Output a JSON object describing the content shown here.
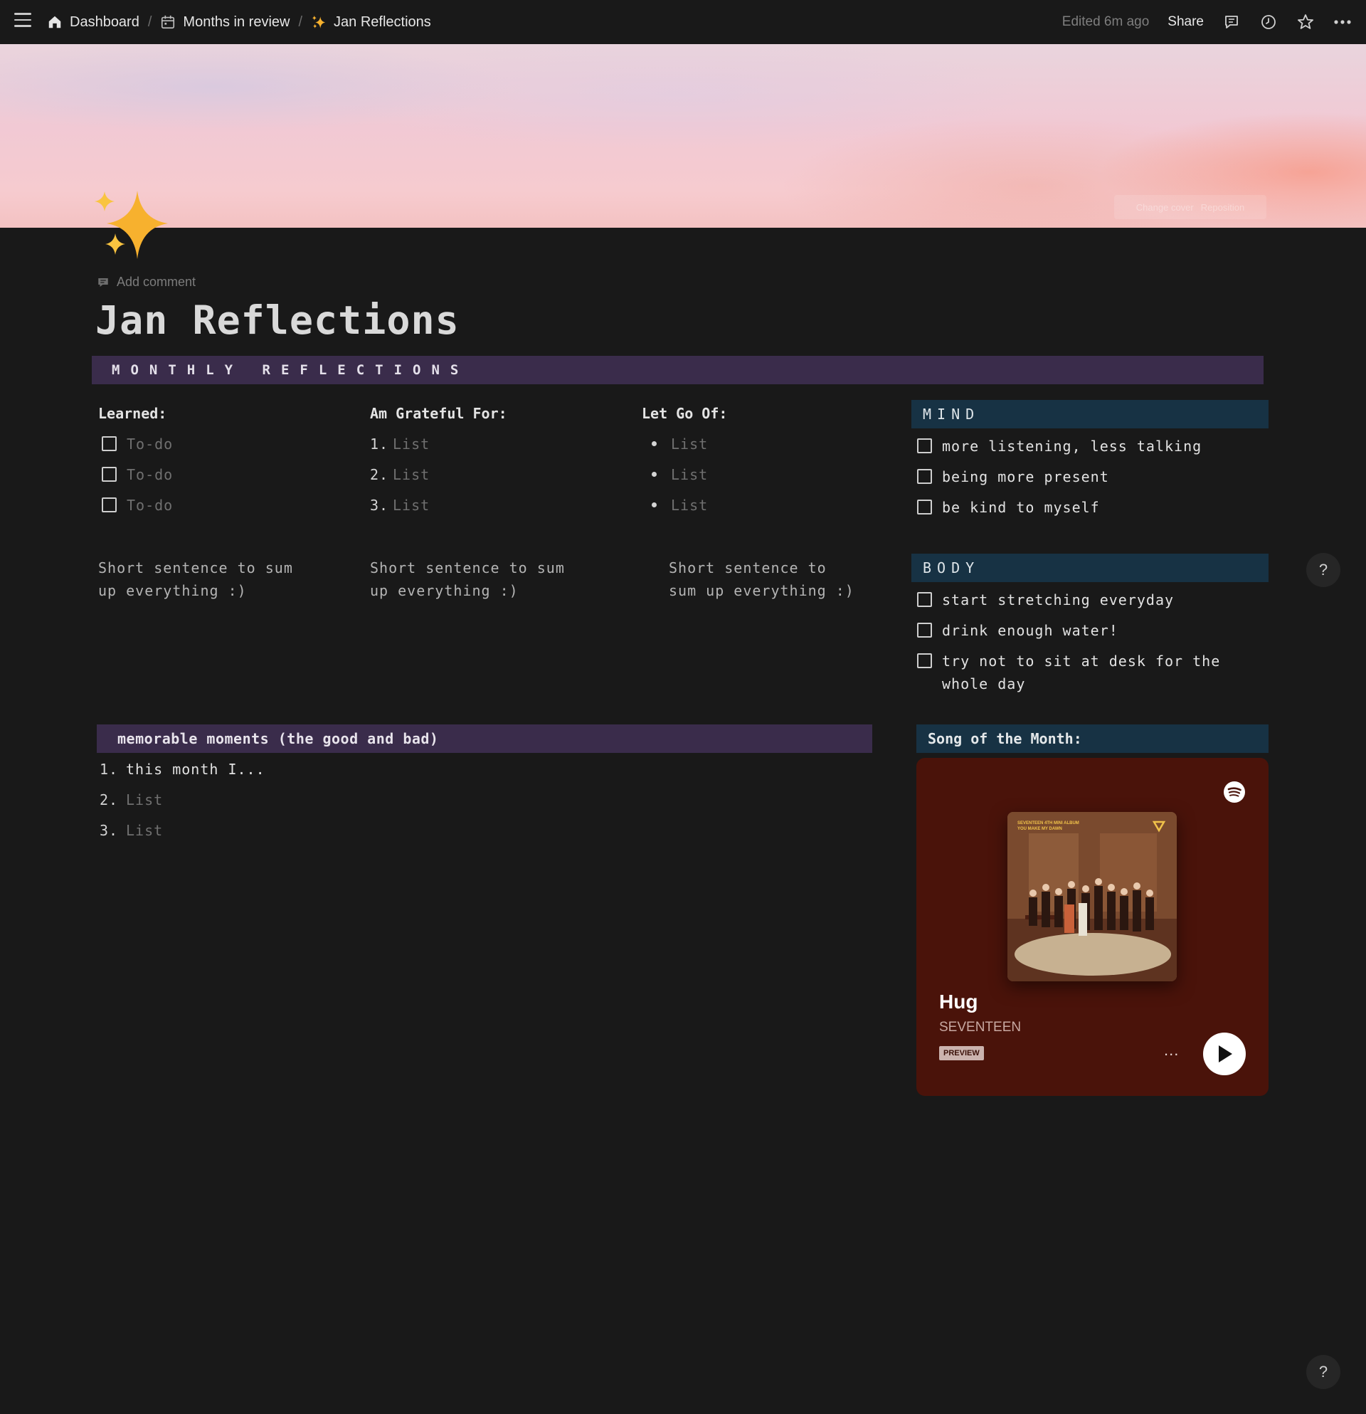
{
  "topbar": {
    "breadcrumbs": [
      {
        "label": "Dashboard",
        "icon": "home-icon"
      },
      {
        "label": "Months in review",
        "icon": "calendar-icon"
      },
      {
        "label": "Jan Reflections",
        "icon": "sparkles-icon"
      }
    ],
    "separator": "/",
    "edited": "Edited 6m ago",
    "share": "Share"
  },
  "cover": {
    "change_cover": "Change cover",
    "reposition": "Reposition"
  },
  "page": {
    "icon": "sparkles-icon",
    "add_comment": "Add comment",
    "title": "Jan Reflections"
  },
  "banner": "MONTHLY REFLECTIONS",
  "learned": {
    "heading": "Learned:",
    "items": [
      "To-do",
      "To-do",
      "To-do"
    ],
    "summary": [
      "Short sentence to sum",
      "up everything :)"
    ]
  },
  "grateful": {
    "heading": "Am Grateful For:",
    "items": [
      {
        "num": "1.",
        "text": "List"
      },
      {
        "num": "2.",
        "text": "List"
      },
      {
        "num": "3.",
        "text": "List"
      }
    ],
    "summary": [
      "Short sentence to sum",
      "up everything :)"
    ]
  },
  "letgo": {
    "heading": "Let Go Of:",
    "items": [
      "List",
      "List",
      "List"
    ],
    "summary": [
      "Short sentence to",
      "sum up everything :)"
    ]
  },
  "mind": {
    "heading": "MIND",
    "items": [
      "more listening, less talking",
      "being more present",
      "be kind to myself"
    ]
  },
  "body": {
    "heading": "BODY",
    "items": [
      "start stretching everyday",
      "drink enough water!",
      "try not to sit at desk for the whole day"
    ]
  },
  "memorable": {
    "heading": "memorable moments (the good and bad)",
    "items": [
      {
        "num": "1.",
        "text": "this month I..."
      },
      {
        "num": "2.",
        "text": "List"
      },
      {
        "num": "3.",
        "text": "List"
      }
    ]
  },
  "song": {
    "heading": "Song of the Month:",
    "title": "Hug",
    "artist": "SEVENTEEN",
    "badge": "PREVIEW",
    "more": "...",
    "album_text": [
      "SEVENTEEN 4TH MINI ALBUM",
      "YOU MAKE MY DAWN"
    ],
    "colors": {
      "card": "#4a130a",
      "accent": "#f0c24a"
    }
  },
  "help": "?",
  "colors": {
    "background": "#191919",
    "purple_banner": "#3a2c4b",
    "blue_banner": "#173244",
    "sparkle": "#f7b12e"
  }
}
